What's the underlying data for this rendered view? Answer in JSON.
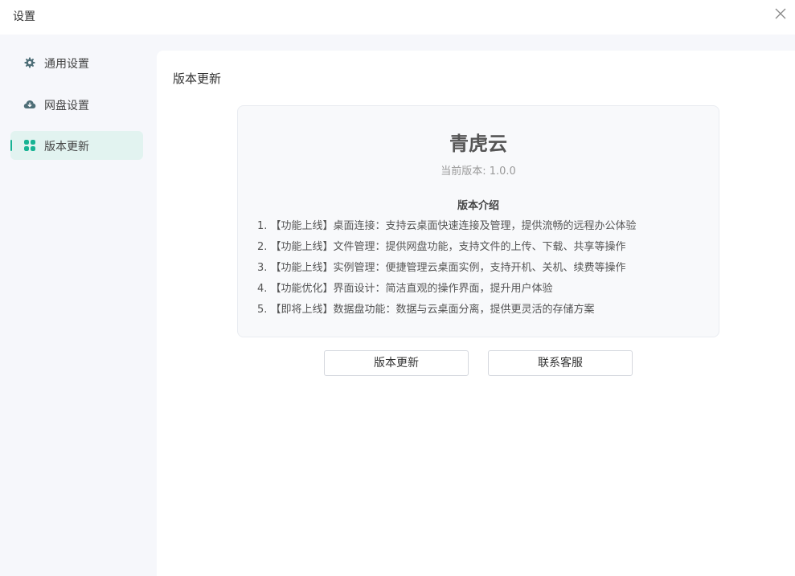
{
  "window": {
    "title": "设置",
    "close_icon": "close-icon"
  },
  "sidebar": {
    "items": [
      {
        "label": "通用设置",
        "icon": "gear-icon",
        "active": false
      },
      {
        "label": "网盘设置",
        "icon": "cloud-download-icon",
        "active": false
      },
      {
        "label": "版本更新",
        "icon": "grid-icon",
        "active": true
      }
    ],
    "active_color": "#18b394",
    "active_bg": "#e2f3f0"
  },
  "main": {
    "section_title": "版本更新",
    "card": {
      "app_name": "青虎云",
      "version_text": "当前版本: 1.0.0",
      "intro_heading": "版本介绍",
      "notes": [
        "1. 【功能上线】桌面连接：支持云桌面快速连接及管理，提供流畅的远程办公体验",
        "2. 【功能上线】文件管理：提供网盘功能，支持文件的上传、下载、共享等操作",
        "3. 【功能上线】实例管理：便捷管理云桌面实例，支持开机、关机、续费等操作",
        "4. 【功能优化】界面设计：简洁直观的操作界面，提升用户体验",
        "5. 【即将上线】数据盘功能：数据与云桌面分离，提供更灵活的存储方案"
      ]
    },
    "buttons": {
      "update_label": "版本更新",
      "support_label": "联系客服"
    }
  }
}
